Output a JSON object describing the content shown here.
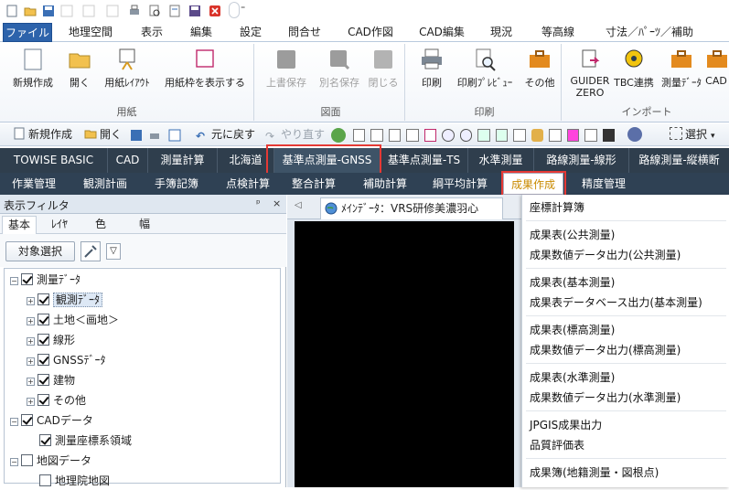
{
  "ribbon": {
    "tabs": [
      "ファイル",
      "地理空間",
      "表示",
      "編集",
      "設定",
      "問合せ",
      "CAD作図",
      "CAD編集",
      "現況",
      "等高線",
      "寸法／ﾊﾟｰﾂ／補助"
    ],
    "groups": {
      "paper": {
        "title": "用紙",
        "buttons": [
          "新規作成",
          "開く",
          "用紙ﾚｲｱｳﾄ",
          "用紙枠を表示する"
        ]
      },
      "drawing": {
        "title": "図面",
        "buttons": [
          "上書保存",
          "別名保存",
          "閉じる"
        ]
      },
      "print": {
        "title": "印刷",
        "buttons": [
          "印刷",
          "印刷ﾌﾟﾚﾋﾞｭｰ",
          "その他"
        ]
      },
      "import": {
        "title": "インポート",
        "buttons": [
          "GUIDER ZERO",
          "TBC連携",
          "測量ﾃﾞｰﾀ",
          "CAD"
        ]
      }
    }
  },
  "toolbar2": {
    "new": "新規作成",
    "open": "開く",
    "undo": "元に戻す",
    "redo": "やり直す",
    "select": "選択"
  },
  "tabbar1": [
    "TOWISE BASIC GATE",
    "CAD",
    "測量計算",
    "北海道",
    "基準点測量-GNSS",
    "基準点測量-TS",
    "水準測量",
    "路線測量-線形",
    "路線測量-縦横断"
  ],
  "tabbar2": [
    "作業管理",
    "観測計画",
    "手簿記簿",
    "点検計算",
    "整合計算",
    "補助計算",
    "綱平均計算",
    "成果作成",
    "精度管理"
  ],
  "left_panel": {
    "title": "表示フィルタ",
    "pin": "ᵖ",
    "close": "×",
    "tabs": [
      "基本",
      "ﾚｲﾔ",
      "色",
      "幅"
    ],
    "target_button": "対象選択",
    "dropdown": "▽",
    "tree": [
      "測量ﾃﾞｰﾀ",
      "観測ﾃﾞｰﾀ",
      "土地＜画地＞",
      "線形",
      "GNSSﾃﾞｰﾀ",
      "建物",
      "その他",
      "CADデータ",
      "測量座標系領域",
      "地図データ",
      "地理院地図"
    ]
  },
  "document": {
    "tab_label": "ﾒｲﾝﾃﾞｰﾀ：VRS研修美濃羽心"
  },
  "menu": {
    "items": [
      "座標計算簿",
      "成果表(公共測量)",
      "成果数値データ出力(公共測量)",
      "成果表(基本測量)",
      "成果表データベース出力(基本測量)",
      "成果表(標高測量)",
      "成果数値データ出力(標高測量)",
      "成果表(水準測量)",
      "成果数値データ出力(水準測量)",
      "JPGIS成果出力",
      "品質評価表",
      "成果簿(地籍測量・図根点)"
    ]
  },
  "colors": {
    "accent": "#2d63ab",
    "dark_tab_bar": "#2f3e4d",
    "highlight_box": "#e53935",
    "selected_tab_text": "#c98a00"
  }
}
